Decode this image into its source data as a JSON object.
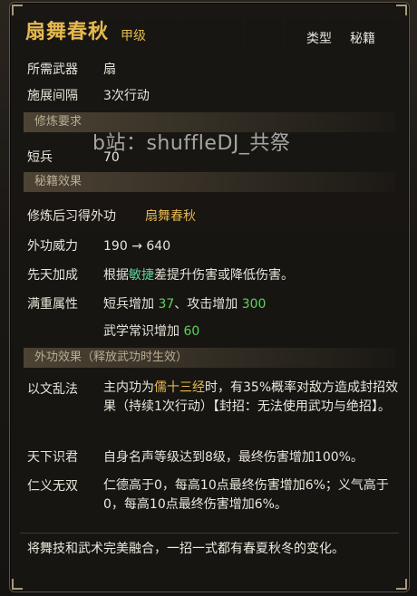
{
  "title": "扇舞春秋",
  "grade": "甲级",
  "type_label": "类型",
  "type_value": "秘籍",
  "weapon": {
    "label": "所需武器",
    "value": "扇"
  },
  "interval": {
    "label": "施展间隔",
    "value": "3次行动"
  },
  "section_requirements": "修炼要求",
  "requirement": {
    "label": "短兵",
    "value": "70"
  },
  "section_effects": "秘籍效果",
  "learned": {
    "label": "修炼后习得外功",
    "value": "扇舞春秋"
  },
  "power": {
    "label": "外功威力",
    "from": "190",
    "arrow": "→",
    "to": "640"
  },
  "innate": {
    "label": "先天加成",
    "pre": "根据",
    "attr": "敏捷",
    "post": "差提升伤害或降低伤害。"
  },
  "full": {
    "label": "满重属性",
    "line1_a": "短兵增加",
    "line1_a_val": "37",
    "line1_sep": "、攻击增加",
    "line1_b_val": "300",
    "line2_a": "武学常识增加",
    "line2_a_val": "60"
  },
  "section_external": "外功效果（释放武功时生效）",
  "yijing": {
    "label": "以文乱法",
    "pre": "主内功为",
    "kungfu": "儒十三经",
    "mid": "时，有35%概率对敌方造成封招效果（持续1次行动）【封招：无法使用武功与绝招】。"
  },
  "tianxia": {
    "label": "天下识君",
    "text": "自身名声等级达到8级，最终伤害增加100%。"
  },
  "renyi": {
    "label": "仁义无双",
    "text": "仁德高于0，每高10点最终伤害增加6%；义气高于0，每高10点最终伤害增加6%。"
  },
  "flavor": "将舞技和武术完美融合，一招一式都有春夏秋冬的变化。",
  "watermark": "b站：shuffleDJ_共祭",
  "colors": {
    "title": "#e6b94e",
    "green": "#5fd35a",
    "highlight": "#e6b94e"
  }
}
